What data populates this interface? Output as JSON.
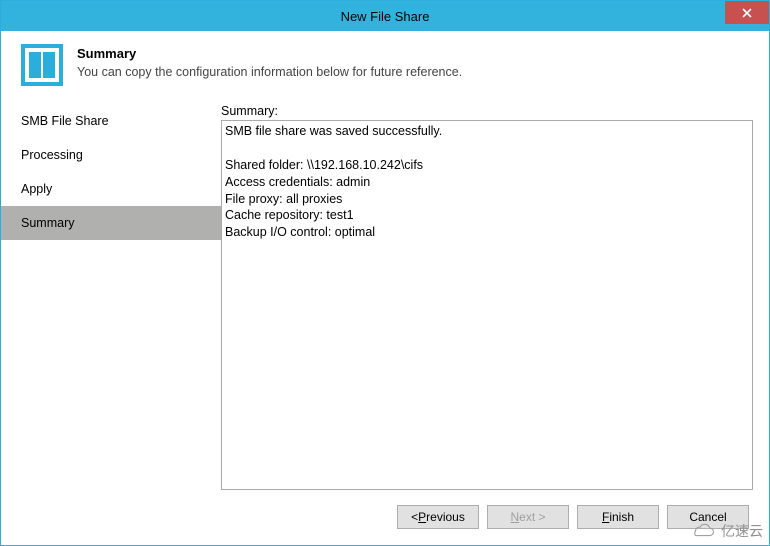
{
  "titlebar": {
    "title": "New File Share"
  },
  "header": {
    "title": "Summary",
    "subtitle": "You can copy the configuration information below for future reference."
  },
  "sidebar": {
    "items": [
      {
        "label": "SMB File Share",
        "selected": false
      },
      {
        "label": "Processing",
        "selected": false
      },
      {
        "label": "Apply",
        "selected": false
      },
      {
        "label": "Summary",
        "selected": true
      }
    ]
  },
  "main": {
    "summary_label": "Summary:",
    "summary_text": "SMB file share was saved successfully.\n\nShared folder: \\\\192.168.10.242\\cifs\nAccess credentials: admin\nFile proxy: all proxies\nCache repository: test1\nBackup I/O control: optimal"
  },
  "footer": {
    "previous_prefix": "< ",
    "previous_u": "P",
    "previous_suffix": "revious",
    "next_u": "N",
    "next_suffix": "ext >",
    "finish_u": "F",
    "finish_suffix": "inish",
    "cancel": "Cancel"
  },
  "watermark": {
    "text": "亿速云"
  }
}
